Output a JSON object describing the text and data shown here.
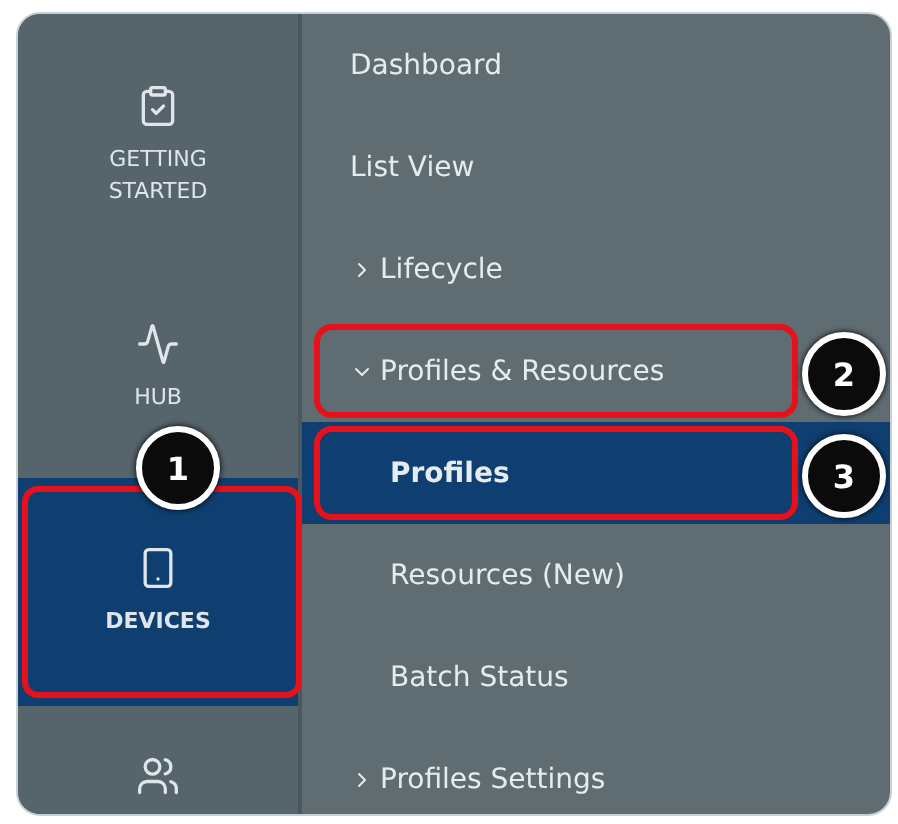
{
  "rail": [
    {
      "kind": "clipboard",
      "label": "GETTING STARTED",
      "selected": false
    },
    {
      "kind": "activity",
      "label": "HUB",
      "selected": false
    },
    {
      "kind": "phone",
      "label": "DEVICES",
      "selected": true,
      "callout": "1"
    },
    {
      "kind": "users",
      "selected": false
    }
  ],
  "menu": [
    {
      "label": "Dashboard",
      "selected": false
    },
    {
      "label": "List View",
      "selected": false
    },
    {
      "label": "Lifecycle",
      "selected": false,
      "expanded": false
    },
    {
      "label": "Profiles & Resources",
      "selected": false,
      "expanded": true,
      "callout": "2",
      "children": [
        {
          "label": "Profiles",
          "selected": true,
          "callout": "3"
        },
        {
          "label": "Resources (New)",
          "selected": false
        },
        {
          "label": "Batch Status",
          "selected": false
        }
      ]
    },
    {
      "label": "Profiles Settings",
      "selected": false,
      "expanded": false
    }
  ]
}
